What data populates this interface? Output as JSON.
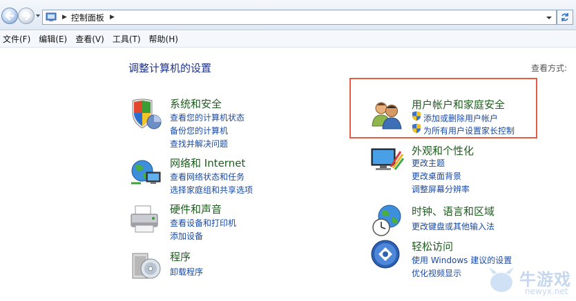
{
  "address": {
    "breadcrumb": "控制面板"
  },
  "menu": [
    "文件(F)",
    "编辑(E)",
    "查看(V)",
    "工具(T)",
    "帮助(H)"
  ],
  "page_title": "调整计算机的设置",
  "view_by_label": "查看方式:",
  "categories": [
    {
      "title": "系统和安全",
      "links": [
        "查看您的计算机状态",
        "备份您的计算机",
        "查找并解决问题"
      ]
    },
    {
      "title": "网络和 Internet",
      "links": [
        "查看网络状态和任务",
        "选择家庭组和共享选项"
      ]
    },
    {
      "title": "硬件和声音",
      "links": [
        "查看设备和打印机",
        "添加设备"
      ]
    },
    {
      "title": "程序",
      "links": [
        "卸载程序"
      ]
    },
    {
      "title": "用户帐户和家庭安全",
      "links": [
        "添加或删除用户帐户",
        "为所有用户设置家长控制"
      ]
    },
    {
      "title": "外观和个性化",
      "links": [
        "更改主题",
        "更改桌面背景",
        "调整屏幕分辨率"
      ]
    },
    {
      "title": "时钟、语言和区域",
      "links": [
        "更改键盘或其他输入法"
      ]
    },
    {
      "title": "轻松访问",
      "links": [
        "使用 Windows 建议的设置",
        "优化视频显示"
      ]
    }
  ],
  "watermark": {
    "text": "牛游戏",
    "sub": "newyx.net"
  },
  "colors": {
    "title_green": "#1e5b1e",
    "link_blue": "#1a4aa3",
    "heading_blue": "#1e3287",
    "highlight_red": "#e75a44"
  }
}
